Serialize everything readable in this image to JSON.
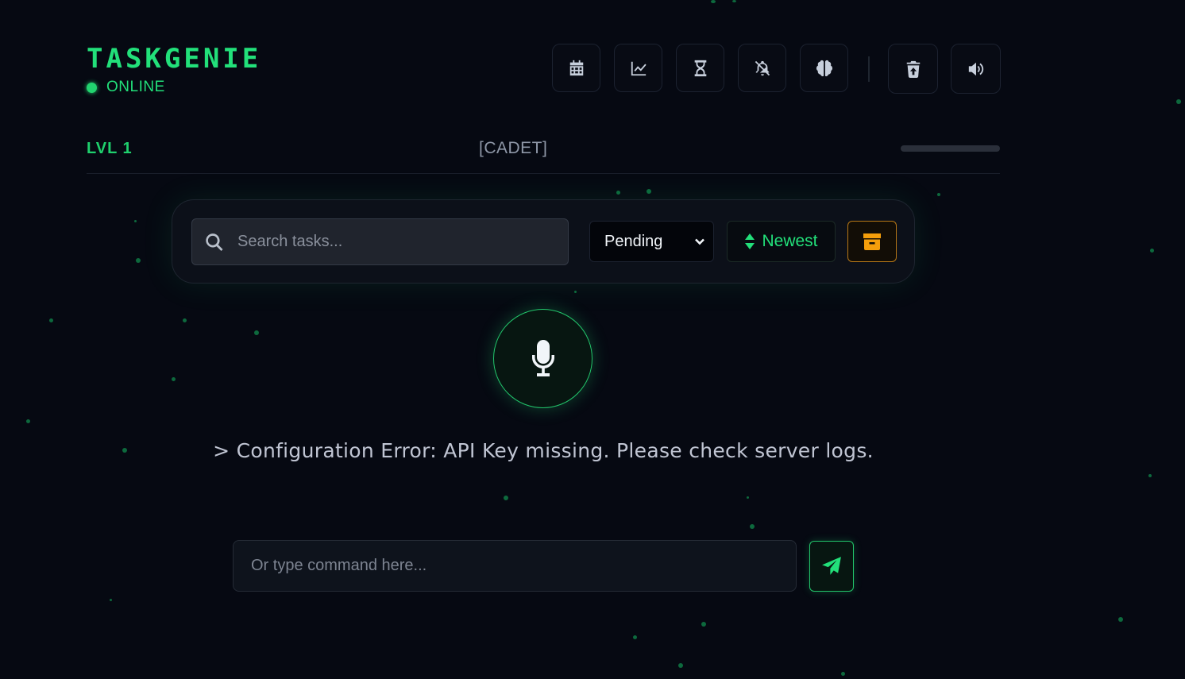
{
  "app": {
    "name": "TASKGENIE",
    "status": "ONLINE",
    "accent_color": "#22e07a"
  },
  "toolbar": {
    "buttons": [
      {
        "icon": "calendar-icon"
      },
      {
        "icon": "chart-line-icon"
      },
      {
        "icon": "hourglass-icon"
      },
      {
        "icon": "bell-slash-icon"
      },
      {
        "icon": "brain-icon"
      },
      {
        "icon": "trash-restore-icon"
      },
      {
        "icon": "volume-icon"
      }
    ]
  },
  "level": {
    "label": "LVL 1",
    "rank": "[CADET]",
    "xp_progress": 0
  },
  "filters": {
    "search_placeholder": "Search tasks...",
    "status_selected": "Pending",
    "sort_label": "Newest",
    "archive_color": "#f59e0b"
  },
  "voice": {
    "mic_icon": "microphone-icon"
  },
  "message": "> Configuration Error: API Key missing. Please check server logs.",
  "command": {
    "placeholder": "Or type command here...",
    "send_icon": "paper-plane-icon"
  }
}
